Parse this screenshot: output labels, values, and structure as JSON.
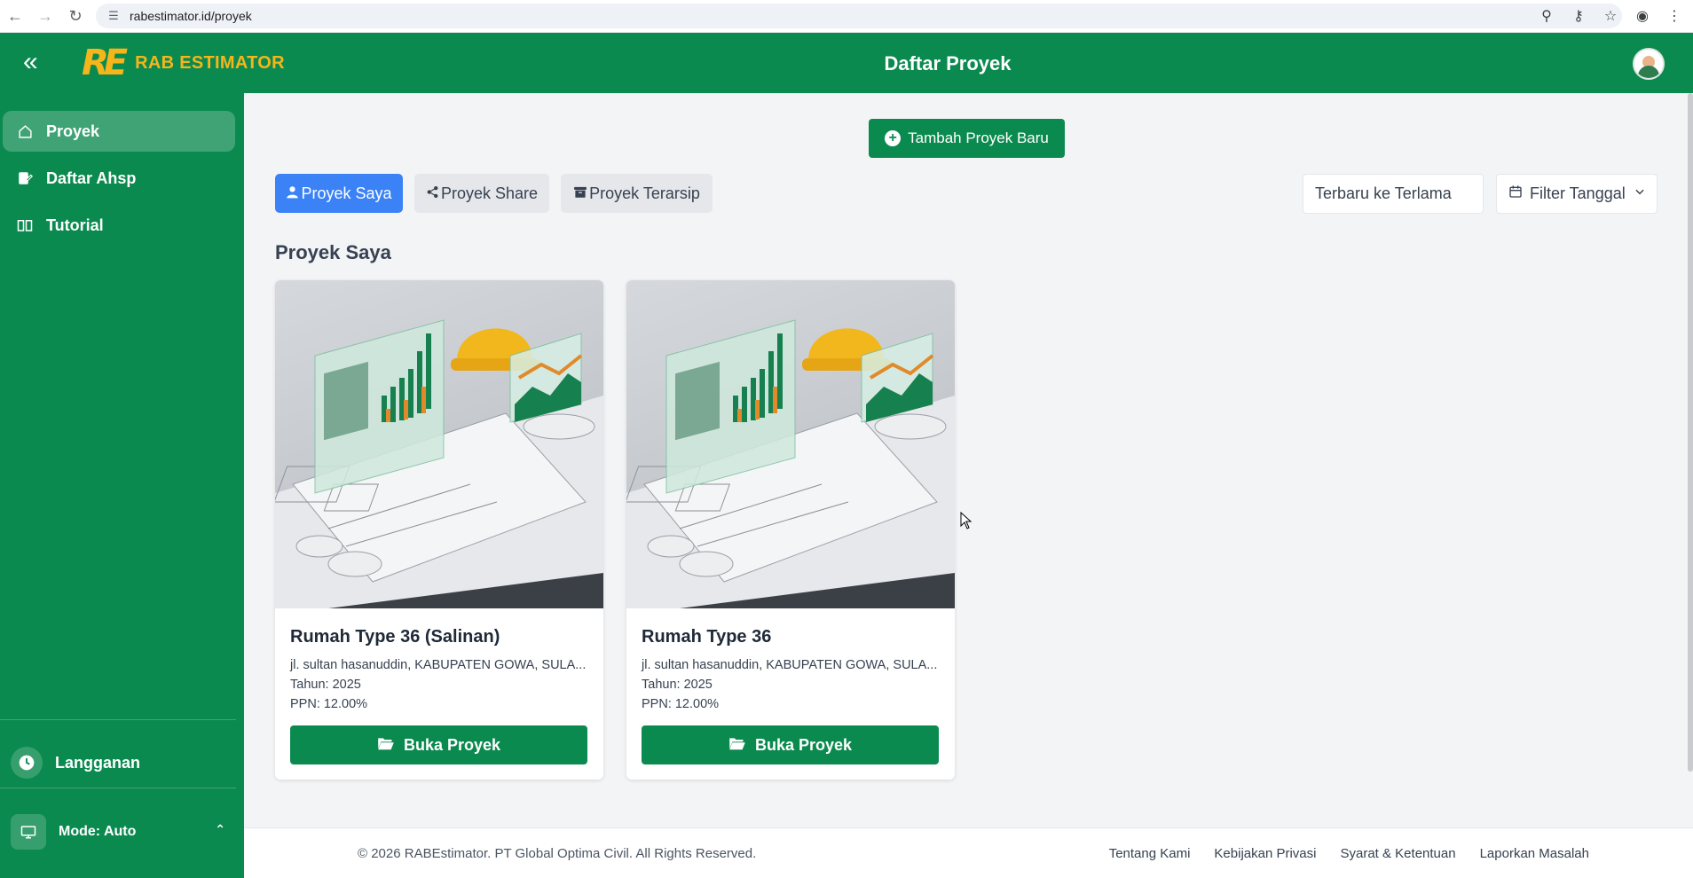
{
  "browser": {
    "url": "rabestimator.id/proyek",
    "icons": [
      "back-arrow-icon",
      "forward-arrow-icon",
      "reload-icon",
      "site-info-icon",
      "zoom-icon",
      "password-key-icon",
      "bookmark-star-icon",
      "profile-icon",
      "menu-kebab-icon"
    ]
  },
  "header": {
    "logo_mark": "RE",
    "logo_text": "RAB ESTIMATOR",
    "title": "Daftar Proyek",
    "colors": {
      "primary": "#0b8a4f",
      "logo": "#f5b51b"
    }
  },
  "sidebar": {
    "items": [
      {
        "label": "Proyek",
        "icon": "home-icon",
        "active": true
      },
      {
        "label": "Daftar Ahsp",
        "icon": "edit-list-icon",
        "active": false
      },
      {
        "label": "Tutorial",
        "icon": "book-icon",
        "active": false
      }
    ],
    "subscription": {
      "label": "Langganan",
      "icon": "clock-icon"
    },
    "mode": {
      "label": "Mode: Auto",
      "icon": "monitor-icon"
    }
  },
  "toolbar": {
    "add_label": "Tambah Proyek Baru",
    "tabs": [
      {
        "label": "Proyek Saya",
        "icon": "user-icon",
        "active": true,
        "color": "#3b82f6"
      },
      {
        "label": "Proyek Share",
        "icon": "share-icon",
        "active": false
      },
      {
        "label": "Proyek Terarsip",
        "icon": "archive-icon",
        "active": false
      }
    ],
    "sort_value": "Terbaru ke Terlama",
    "filter_label": "Filter Tanggal"
  },
  "section_title": "Proyek Saya",
  "projects": [
    {
      "title": "Rumah Type 36 (Salinan)",
      "address": "jl. sultan hasanuddin, KABUPATEN GOWA, SULA...",
      "year": "Tahun: 2025",
      "ppn": "PPN: 12.00%",
      "button": "Buka Proyek"
    },
    {
      "title": "Rumah Type 36",
      "address": "jl. sultan hasanuddin, KABUPATEN GOWA, SULA...",
      "year": "Tahun: 2025",
      "ppn": "PPN: 12.00%",
      "button": "Buka Proyek"
    }
  ],
  "footer": {
    "copyright": "© 2026 RABEstimator. PT Global Optima Civil. All Rights Reserved.",
    "links": [
      "Tentang Kami",
      "Kebijakan Privasi",
      "Syarat & Ketentuan",
      "Laporkan Masalah"
    ]
  }
}
